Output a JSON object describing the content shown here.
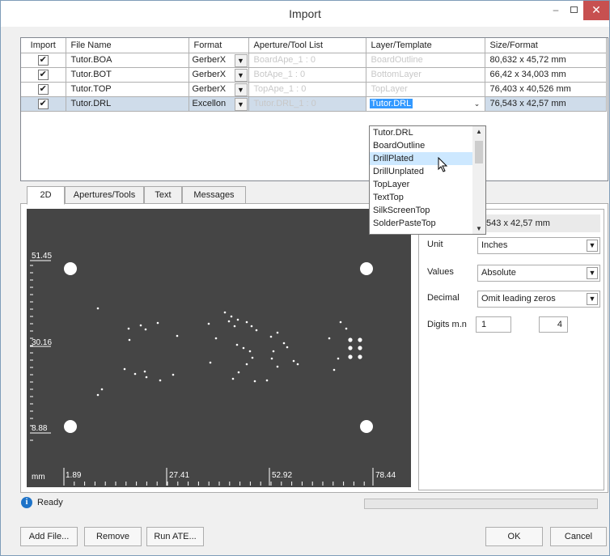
{
  "window": {
    "title": "Import",
    "minimize": "–",
    "close": "✕"
  },
  "table": {
    "headers": [
      "Import",
      "File Name",
      "Format",
      "Aperture/Tool List",
      "Layer/Template",
      "Size/Format"
    ],
    "rows": [
      {
        "checked": "✔",
        "name": "Tutor.BOA",
        "format": "GerberX",
        "aperture": "BoardApe_1 : 0",
        "layer": "BoardOutline",
        "size": "80,632 x 45,72 mm"
      },
      {
        "checked": "✔",
        "name": "Tutor.BOT",
        "format": "GerberX",
        "aperture": "BotApe_1 : 0",
        "layer": "BottomLayer",
        "size": "66,42 x 34,003 mm"
      },
      {
        "checked": "✔",
        "name": "Tutor.TOP",
        "format": "GerberX",
        "aperture": "TopApe_1 : 0",
        "layer": "TopLayer",
        "size": "76,403 x 40,526 mm"
      },
      {
        "checked": "✔",
        "name": "Tutor.DRL",
        "format": "Excellon",
        "aperture": "Tutor.DRL_1 : 0",
        "layer": "Tutor.DRL",
        "size": "76,543 x 42,57 mm"
      }
    ]
  },
  "dropdown": {
    "options": [
      "Tutor.DRL",
      "BoardOutline",
      "DrillPlated",
      "DrillUnplated",
      "TopLayer",
      "TextTop",
      "SilkScreenTop",
      "SolderPasteTop"
    ],
    "hovered_index": 2
  },
  "tabs": [
    "2D",
    "Apertures/Tools",
    "Text",
    "Messages"
  ],
  "view2d": {
    "y_labels": [
      "51.45",
      "30.16",
      "8.88"
    ],
    "x_labels": [
      "mm",
      "1.89",
      "27.41",
      "52.92",
      "78.44"
    ]
  },
  "props": {
    "size_display": ",543 x 42,57 mm",
    "unit_label": "Unit",
    "unit_value": "Inches",
    "values_label": "Values",
    "values_value": "Absolute",
    "decimal_label": "Decimal",
    "decimal_value": "Omit leading zeros",
    "digits_label": "Digits m.n",
    "digits_m": "1",
    "digits_n": "4"
  },
  "status": {
    "text": "Ready",
    "icon": "info-icon"
  },
  "buttons": {
    "add_file": "Add File...",
    "remove": "Remove",
    "run_ate": "Run ATE...",
    "ok": "OK",
    "cancel": "Cancel"
  }
}
